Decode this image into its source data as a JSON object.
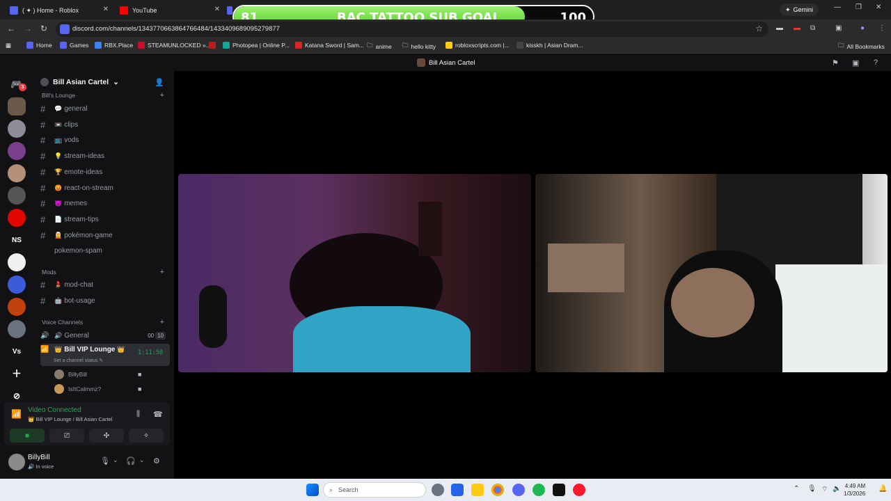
{
  "browser": {
    "tabs": [
      {
        "title": "( ✦ ) Home - Roblox"
      },
      {
        "title": "YouTube"
      }
    ],
    "gemini_label": "Gemini",
    "url": "discord.com/channels/1343770663864766484/1433409689095279877",
    "bookmarks": [
      "Home",
      "Games",
      "RBX.Place",
      "STEAMUNLOCKED »...",
      "Photopea | Online P...",
      "Katana Sword | Sam...",
      "anime",
      "hello kitty",
      "robloxscripts.com |...",
      "kisskh | Asian Dram..."
    ],
    "all_bookmarks": "All Bookmarks"
  },
  "sub_goal": {
    "current": "81",
    "label": "BAC TATTOO SUB GOAL",
    "target": "100",
    "progress": 0.81,
    "fill_color": "#57d12a"
  },
  "discord": {
    "title": "Bill Asian Cartel",
    "server_name": "Bill Asian Cartel",
    "notification_badge": "3",
    "categories": {
      "lounge": "Bill's Lounge",
      "mods": "Mods",
      "voice": "Voice Channels"
    },
    "text_channels": [
      {
        "emoji": "💬",
        "name": "general"
      },
      {
        "emoji": "📼",
        "name": "clips"
      },
      {
        "emoji": "📺",
        "name": "vods"
      },
      {
        "emoji": "💡",
        "name": "stream-ideas"
      },
      {
        "emoji": "🏆",
        "name": "emote-ideas"
      },
      {
        "emoji": "😡",
        "name": "react-on-stream"
      },
      {
        "emoji": "😈",
        "name": "memes"
      },
      {
        "emoji": "📄",
        "name": "stream-tips"
      },
      {
        "emoji": "🧝",
        "name": "pokémon-game"
      },
      {
        "emoji": "",
        "name": "pokemon-spam"
      }
    ],
    "mod_channels": [
      {
        "emoji": "💄",
        "name": "mod-chat"
      },
      {
        "emoji": "🤖",
        "name": "bot-usage"
      }
    ],
    "voice_channels": {
      "general": {
        "name": "General",
        "count_a": "00",
        "count_b": "10"
      },
      "vip": {
        "name": "Bill VIP Lounge",
        "timer": "1:11:50",
        "status": "Set a channel status"
      }
    },
    "voice_users": [
      "BillyBill",
      "IsItCalmmz?"
    ],
    "voice_panel": {
      "state": "Video Connected",
      "location": "Bill VIP Lounge / Bill Asian Cartel"
    },
    "user": {
      "name": "BillyBill",
      "status": "In voice"
    }
  },
  "taskbar": {
    "search_placeholder": "Search",
    "time": "4:49 AM",
    "date": "1/3/2026"
  }
}
